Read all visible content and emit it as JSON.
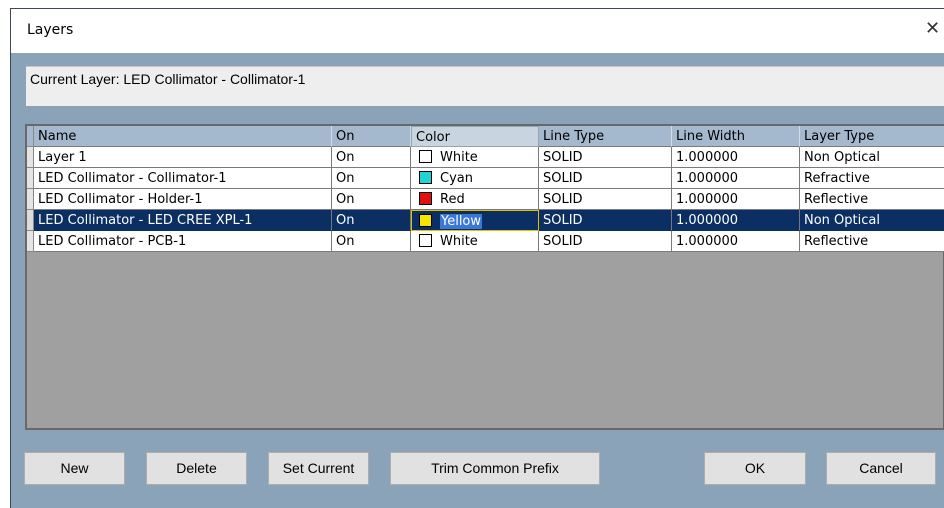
{
  "window": {
    "title": "Layers",
    "close_glyph": "✕"
  },
  "current_layer_text": "Current Layer: LED Collimator - Collimator-1",
  "columns": [
    "Name",
    "On",
    "Color",
    "Line Type",
    "Line Width",
    "Layer Type"
  ],
  "rows": [
    {
      "name": "Layer 1",
      "on": "On",
      "color": "White",
      "swatch": "#ffffff",
      "line_type": "SOLID",
      "line_width": "1.000000",
      "layer_type": "Non Optical"
    },
    {
      "name": "LED Collimator - Collimator-1",
      "on": "On",
      "color": "Cyan",
      "swatch": "#22d3d3",
      "line_type": "SOLID",
      "line_width": "1.000000",
      "layer_type": "Refractive"
    },
    {
      "name": "LED Collimator - Holder-1",
      "on": "On",
      "color": "Red",
      "swatch": "#e01010",
      "line_type": "SOLID",
      "line_width": "1.000000",
      "layer_type": "Reflective"
    },
    {
      "name": "LED Collimator - LED CREE XPL-1",
      "on": "On",
      "color": "Yellow",
      "swatch": "#f5e400",
      "line_type": "SOLID",
      "line_width": "1.000000",
      "layer_type": "Non Optical",
      "selected": true
    },
    {
      "name": "LED Collimator - PCB-1",
      "on": "On",
      "color": "White",
      "swatch": "#ffffff",
      "line_type": "SOLID",
      "line_width": "1.000000",
      "layer_type": "Reflective"
    }
  ],
  "buttons": {
    "new": "New",
    "delete": "Delete",
    "set_current": "Set Current",
    "trim_prefix": "Trim Common Prefix",
    "ok": "OK",
    "cancel": "Cancel"
  }
}
